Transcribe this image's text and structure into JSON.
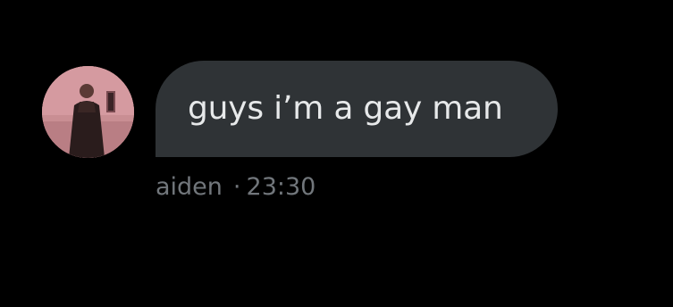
{
  "message": {
    "text": "guys i’m a gay man",
    "sender": "aiden",
    "separator": "·",
    "time": "23:30"
  },
  "colors": {
    "background": "#000000",
    "bubble": "#2f3336",
    "bubble_text": "#e7e9ea",
    "meta_text": "#71767b",
    "avatar_tint": "#c98e93"
  }
}
